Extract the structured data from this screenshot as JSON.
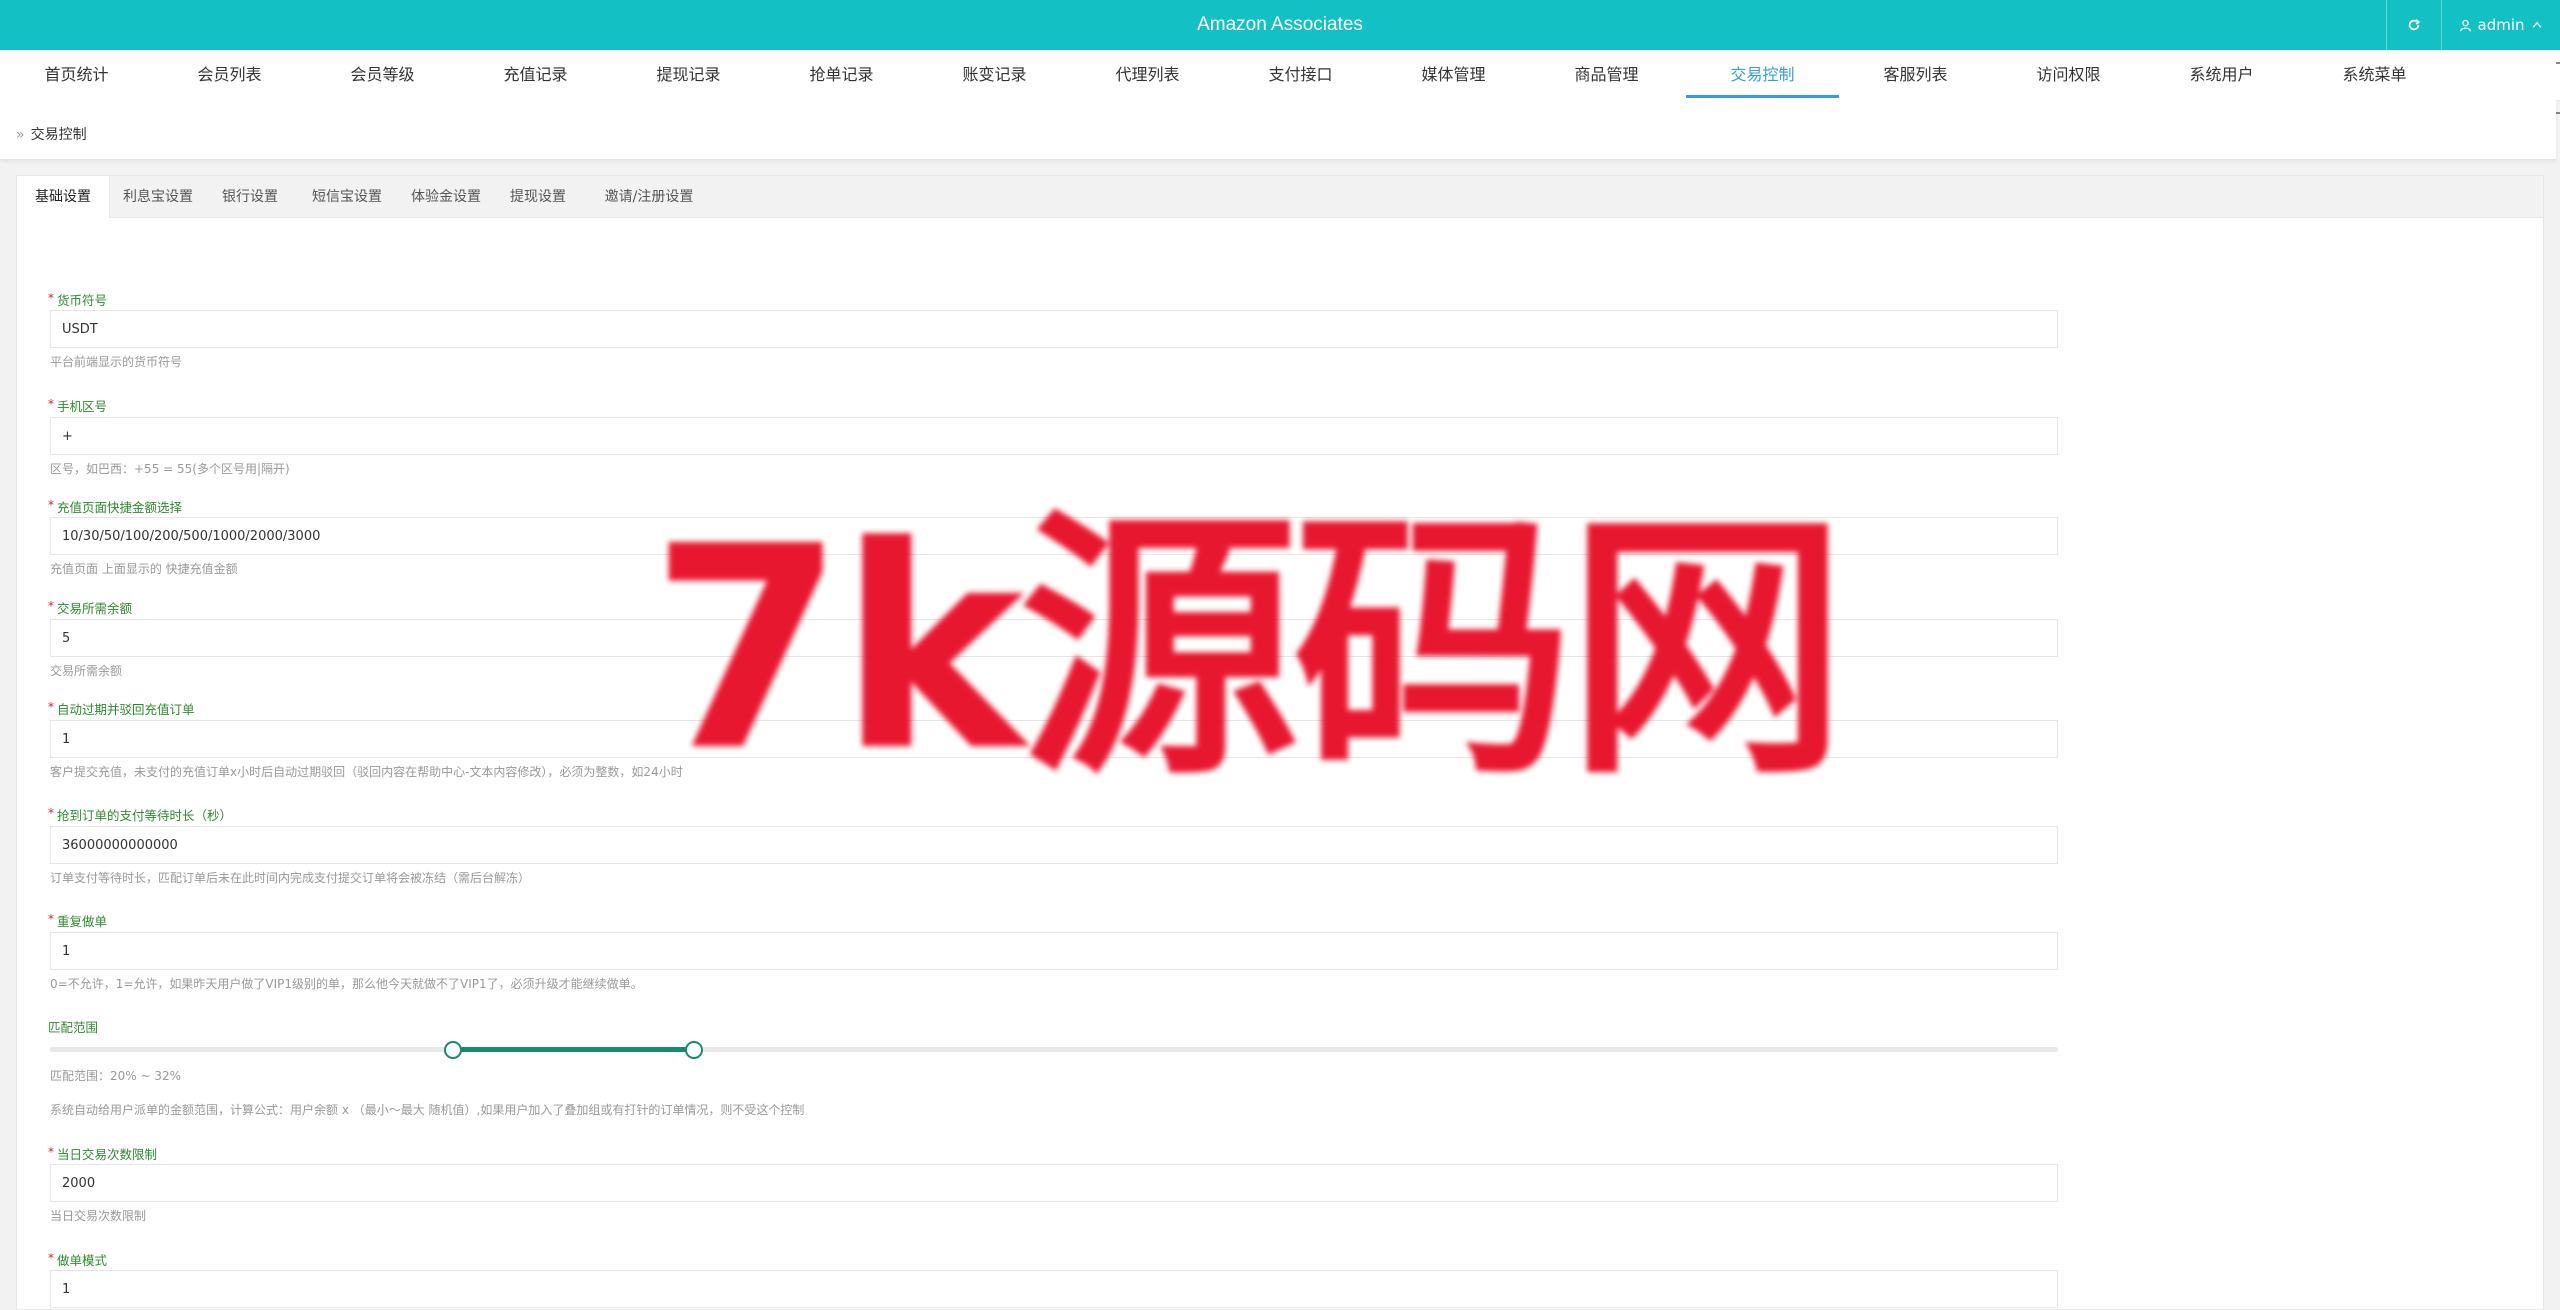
{
  "header": {
    "title": "Amazon Associates",
    "user": "admin"
  },
  "nav": {
    "items": [
      "首页统计",
      "会员列表",
      "会员等级",
      "充值记录",
      "提现记录",
      "抢单记录",
      "账变记录",
      "代理列表",
      "支付接口",
      "媒体管理",
      "商品管理",
      "交易控制",
      "客服列表",
      "访问权限",
      "系统用户",
      "系统菜单"
    ],
    "active_index": 11
  },
  "breadcrumb": {
    "label": "交易控制"
  },
  "tabs": [
    "基础设置",
    "利息宝设置",
    "银行设置",
    "短信宝设置",
    "体验金设置",
    "提现设置",
    "邀请/注册设置"
  ],
  "form": {
    "fields": [
      {
        "label": "货币符号",
        "value": "USDT",
        "help": "平台前端显示的货币符号"
      },
      {
        "label": "手机区号",
        "value": "+",
        "help": "区号，如巴西：+55 = 55(多个区号用|隔开)"
      },
      {
        "label": "充值页面快捷金额选择",
        "value": "10/30/50/100/200/500/1000/2000/3000",
        "help": "充值页面 上面显示的 快捷充值金额"
      },
      {
        "label": "交易所需余额",
        "value": "5",
        "help": "交易所需余额"
      },
      {
        "label": "自动过期并驳回充值订单",
        "value": "1",
        "help": "客户提交充值，未支付的充值订单x小时后自动过期驳回（驳回内容在帮助中心-文本内容修改），必须为整数，如24小时"
      },
      {
        "label": "抢到订单的支付等待时长（秒）",
        "value": "36000000000000",
        "help": "订单支付等待时长，匹配订单后未在此时间内完成支付提交订单将会被冻结（需后台解冻）"
      },
      {
        "label": "重复做单",
        "value": "1",
        "help": "0=不允许，1=允许，如果昨天用户做了VIP1级别的单，那么他今天就做不了VIP1了，必须升级才能继续做单。"
      }
    ],
    "range": {
      "label": "匹配范围",
      "min": 20,
      "max": 32,
      "scale_max": 100,
      "help": "匹配范围：20% ~ 32%",
      "note": "系统自动给用户派单的金额范围，计算公式：用户余额 x （最小～最大 随机值）,如果用户加入了叠加组或有打针的订单情况，则不受这个控制"
    },
    "daily_limit": {
      "label": "当日交易次数限制",
      "value": "2000",
      "help": "当日交易次数限制"
    },
    "mode": {
      "label": "做单模式",
      "value": "1"
    }
  },
  "watermark": {
    "text": "7k源码网"
  },
  "colors": {
    "header_bg": "#13c0c4",
    "active_nav": "#3a9bd8",
    "label_green": "#2d8a2d",
    "slider": "#1a8a6e",
    "watermark": "#e8102a"
  }
}
